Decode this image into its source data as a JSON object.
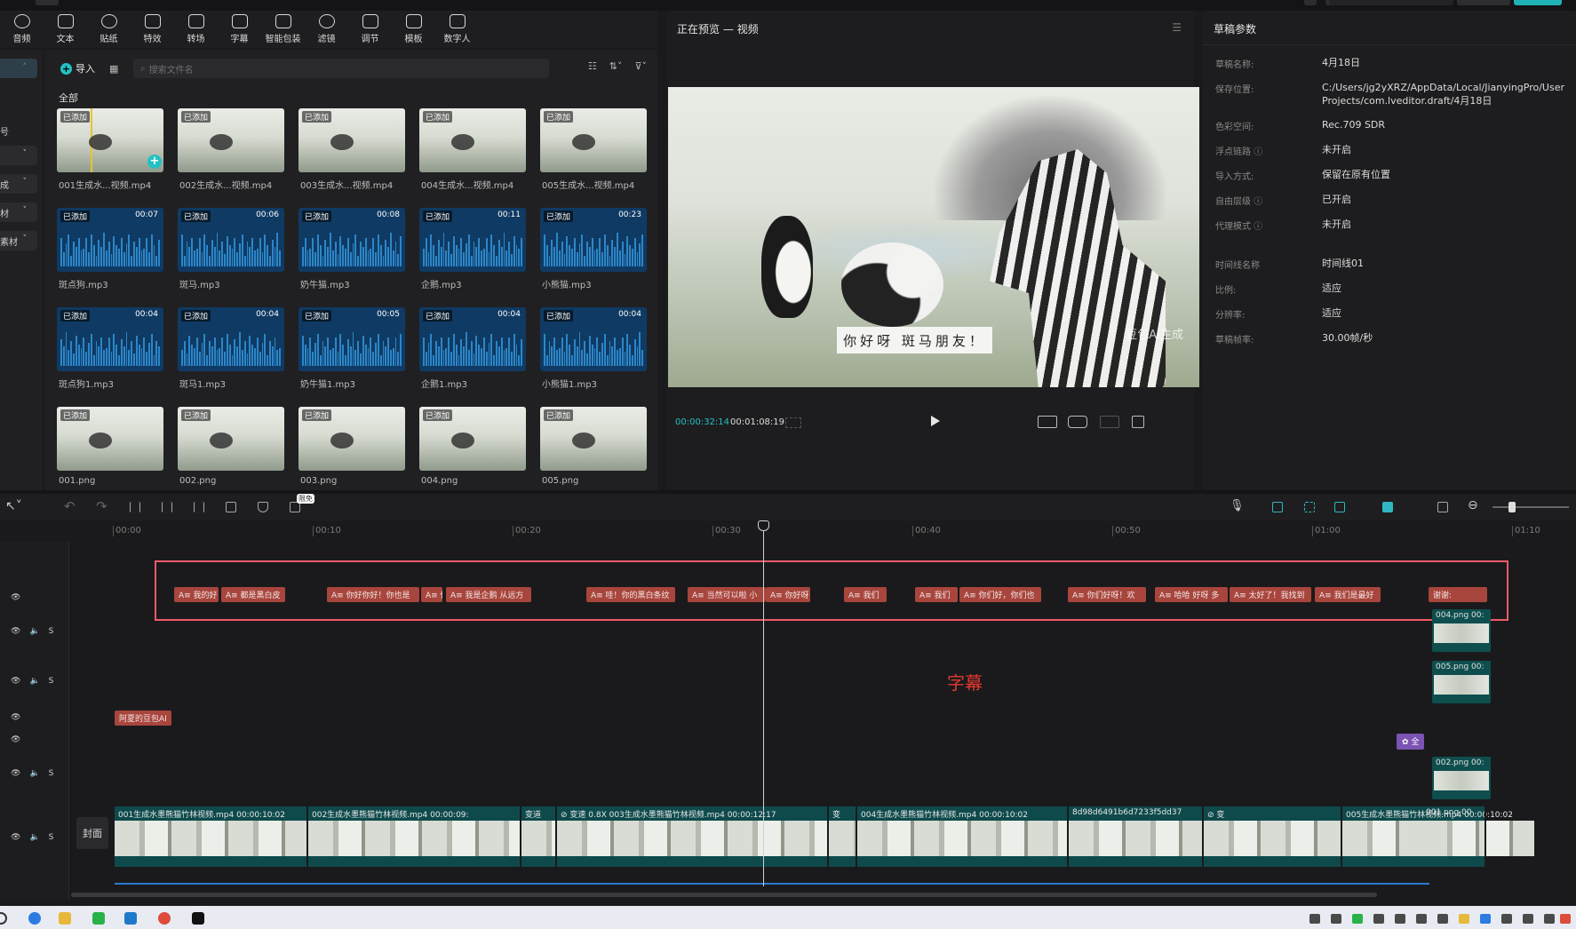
{
  "toolbar": {
    "tools": [
      {
        "label": "音频",
        "icon": "audio-icon"
      },
      {
        "label": "文本",
        "icon": "text-icon"
      },
      {
        "label": "贴纸",
        "icon": "sticker-icon"
      },
      {
        "label": "特效",
        "icon": "effects-icon"
      },
      {
        "label": "转场",
        "icon": "transition-icon"
      },
      {
        "label": "字幕",
        "icon": "caption-icon"
      },
      {
        "label": "智能包装",
        "icon": "smart-package-icon"
      },
      {
        "label": "滤镜",
        "icon": "filter-icon"
      },
      {
        "label": "调节",
        "icon": "adjust-icon"
      },
      {
        "label": "模板",
        "icon": "template-icon"
      },
      {
        "label": "数字人",
        "icon": "digital-human-icon"
      }
    ]
  },
  "sidebar": {
    "items": [
      {
        "label": "",
        "chevron": "˄"
      },
      {
        "label": "",
        "chevron": "˅"
      },
      {
        "label": "成",
        "chevron": "˅"
      },
      {
        "label": "材",
        "chevron": "˅"
      },
      {
        "label": "素材",
        "chevron": "˅"
      }
    ],
    "side_char": "号"
  },
  "media": {
    "import_label": "导入",
    "search_placeholder": "搜索文件名",
    "filter_all": "全部",
    "items": [
      {
        "name": "001生成水...视频.mp4",
        "type": "img",
        "badge": "已添加",
        "duration": ""
      },
      {
        "name": "002生成水...视频.mp4",
        "type": "img",
        "badge": "已添加",
        "duration": ""
      },
      {
        "name": "003生成水...视频.mp4",
        "type": "img",
        "badge": "已添加",
        "duration": ""
      },
      {
        "name": "004生成水...视频.mp4",
        "type": "img",
        "badge": "已添加",
        "duration": ""
      },
      {
        "name": "005生成水...视频.mp4",
        "type": "img",
        "badge": "已添加",
        "duration": ""
      },
      {
        "name": "斑点狗.mp3",
        "type": "aud",
        "badge": "已添加",
        "duration": "00:07"
      },
      {
        "name": "斑马.mp3",
        "type": "aud",
        "badge": "已添加",
        "duration": "00:06"
      },
      {
        "name": "奶牛猫.mp3",
        "type": "aud",
        "badge": "已添加",
        "duration": "00:08"
      },
      {
        "name": "企鹅.mp3",
        "type": "aud",
        "badge": "已添加",
        "duration": "00:11"
      },
      {
        "name": "小熊猫.mp3",
        "type": "aud",
        "badge": "已添加",
        "duration": "00:23"
      },
      {
        "name": "斑点狗1.mp3",
        "type": "aud",
        "badge": "已添加",
        "duration": "00:04"
      },
      {
        "name": "斑马1.mp3",
        "type": "aud",
        "badge": "已添加",
        "duration": "00:04"
      },
      {
        "name": "奶牛猫1.mp3",
        "type": "aud",
        "badge": "已添加",
        "duration": "00:05"
      },
      {
        "name": "企鹅1.mp3",
        "type": "aud",
        "badge": "已添加",
        "duration": "00:04"
      },
      {
        "name": "小熊猫1.mp3",
        "type": "aud",
        "badge": "已添加",
        "duration": "00:04"
      },
      {
        "name": "001.png",
        "type": "img",
        "badge": "已添加",
        "duration": ""
      },
      {
        "name": "002.png",
        "type": "img",
        "badge": "已添加",
        "duration": ""
      },
      {
        "name": "003.png",
        "type": "img",
        "badge": "已添加",
        "duration": ""
      },
      {
        "name": "004.png",
        "type": "img",
        "badge": "已添加",
        "duration": ""
      },
      {
        "name": "005.png",
        "type": "img",
        "badge": "已添加",
        "duration": ""
      }
    ]
  },
  "preview": {
    "title": "正在预览 — 视频",
    "subtitle_text": "你好呀 斑马朋友！",
    "watermark": "豆包AI生成",
    "current_time": "00:00:32:14",
    "total_time": "00:01:08:19"
  },
  "props": {
    "title": "草稿参数",
    "rows": [
      {
        "label": "草稿名称:",
        "value": "4月18日"
      },
      {
        "label": "保存位置:",
        "value": "C:/Users/jg2yXRZ/AppData/Local/JianyingPro/User Projects/com.lveditor.draft/4月18日"
      },
      {
        "label": "色彩空间:",
        "value": "Rec.709 SDR"
      },
      {
        "label": "浮点链路 ⓘ",
        "value": "未开启"
      },
      {
        "label": "导入方式:",
        "value": "保留在原有位置"
      },
      {
        "label": "自由层级 ⓘ",
        "value": "已开启"
      },
      {
        "label": "代理模式 ⓘ",
        "value": "未开启"
      },
      {
        "label": "时间线名称",
        "value": "时间线01"
      },
      {
        "label": "比例:",
        "value": "适应"
      },
      {
        "label": "分辨率:",
        "value": "适应"
      },
      {
        "label": "草稿帧率:",
        "value": "30.00帧/秒"
      }
    ]
  },
  "timeline": {
    "free_badge": "限免",
    "ruler": [
      "00:00",
      "00:10",
      "00:20",
      "00:30",
      "00:40",
      "00:50",
      "01:00",
      "01:10"
    ],
    "subtitle_clips": [
      "A≡ 我的好",
      "A≡ 都是黑白皮",
      "A≡ 你好你好！你也是",
      "A≡ 你",
      "A≡ 我是企鹅 从远方",
      "A≡ 哇！你的黑白条纹",
      "A≡ 当然可以啦 小",
      "A≡ 你好呀",
      "A≡ 我们",
      "A≡ 我们",
      "A≡ 你们好，你们也",
      "A≡ 你们好呀！欢",
      "A≡ 哈哈 好呀 多",
      "A≡ 太好了！我找到",
      "A≡ 我们是最好",
      "谢谢:"
    ],
    "annotation": "字幕",
    "text_clip": "阿夏的豆包AI",
    "effect_clip": "✿ 全",
    "image_clips": [
      "004.png 00:",
      "005.png 00:",
      "002.png 00:"
    ],
    "cover_label": "封面",
    "video_clips": [
      "001生成水墨熊猫竹林视频.mp4   00:00:10:02",
      "002生成水墨熊猫竹林视频.mp4   00:00:09:",
      "变道",
      "⊘ 变速 0.8X  003生成水墨熊猫竹林视频.mp4   00:00:12:17",
      "变",
      "004生成水墨熊猫竹林视频.mp4   00:00:10:02",
      "8d98d6491b6d7233f5dd37",
      "⊘ 变",
      "005生成水墨熊猫竹林视频.mp4   00:00:10:02",
      "001.png  00"
    ]
  }
}
